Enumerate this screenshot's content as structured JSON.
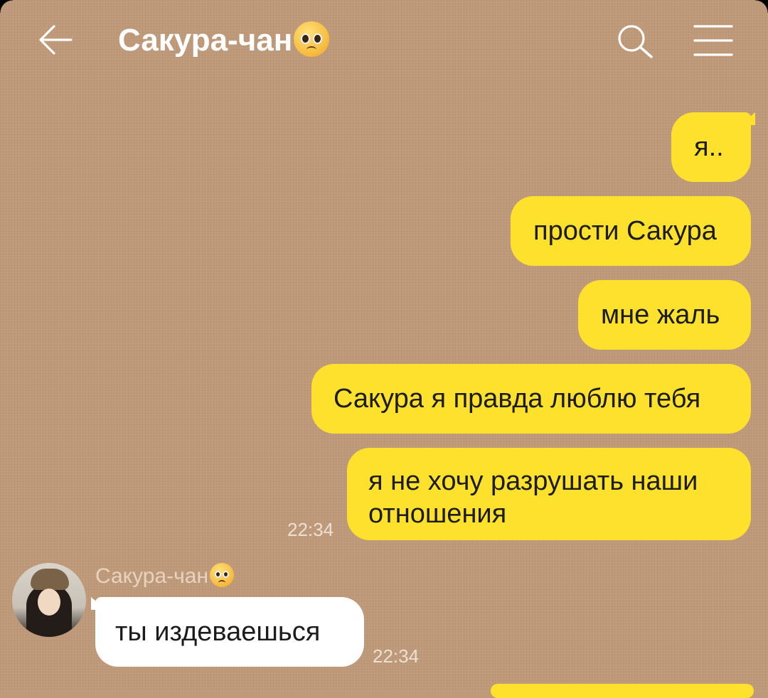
{
  "header": {
    "title": "Сакура-чан",
    "title_emoji": "pleading-face-emoji",
    "back_icon": "arrow-left-icon",
    "search_icon": "search-icon",
    "menu_icon": "hamburger-menu-icon"
  },
  "messages": {
    "outgoing": [
      {
        "text": "я.."
      },
      {
        "text": "прости Сакура"
      },
      {
        "text": "мне жаль"
      },
      {
        "text": "Сакура я правда люблю тебя"
      },
      {
        "text": "я не хочу разрушать наши отношения",
        "time": "22:34"
      }
    ],
    "incoming": {
      "sender": "Сакура-чан",
      "sender_emoji": "pleading-face-emoji",
      "text": "ты издеваешься",
      "time": "22:34"
    }
  },
  "colors": {
    "background": "#bf9a7a",
    "outgoing_bubble": "#fde12d",
    "incoming_bubble": "#ffffff",
    "header_text": "#ffffff"
  }
}
